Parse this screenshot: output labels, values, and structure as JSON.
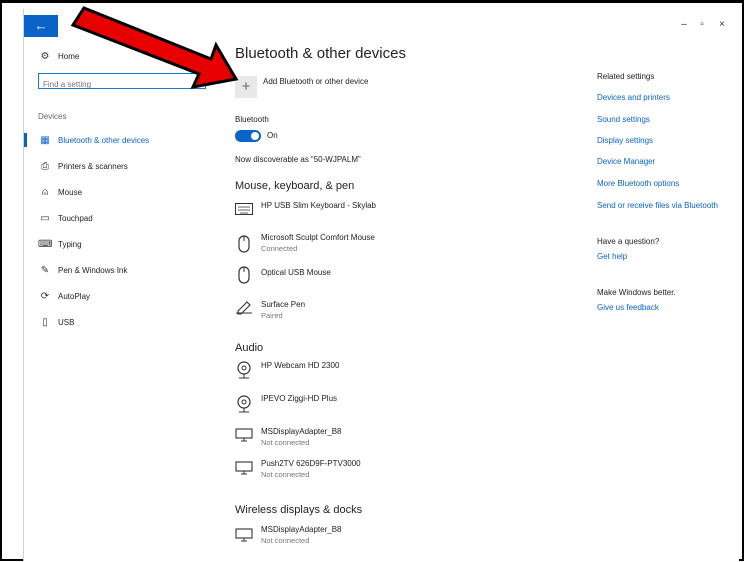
{
  "window": {
    "back_icon": "←",
    "minimize_icon": "–",
    "restore_icon": "▫",
    "close_icon": "×"
  },
  "nav": {
    "home_label": "Home",
    "search_placeholder": "Find a setting",
    "section_label": "Devices",
    "items": [
      {
        "label": "Bluetooth & other devices",
        "icon": "bluetooth-devices-icon",
        "active": true
      },
      {
        "label": "Printers & scanners",
        "icon": "printer-icon"
      },
      {
        "label": "Mouse",
        "icon": "mouse-icon"
      },
      {
        "label": "Touchpad",
        "icon": "touchpad-icon"
      },
      {
        "label": "Typing",
        "icon": "keyboard-icon"
      },
      {
        "label": "Pen & Windows Ink",
        "icon": "pen-icon"
      },
      {
        "label": "AutoPlay",
        "icon": "autoplay-icon"
      },
      {
        "label": "USB",
        "icon": "usb-icon"
      }
    ]
  },
  "main": {
    "title": "Bluetooth & other devices",
    "add_label": "Add Bluetooth or other device",
    "bluetooth_label": "Bluetooth",
    "bluetooth_state": "On",
    "discoverable": "Now discoverable as “50-WJPALM”",
    "sections": {
      "mouse": {
        "title": "Mouse, keyboard, & pen",
        "devices": [
          {
            "name": "HP USB Slim Keyboard - Skylab",
            "status": "",
            "icon": "keyboard-icon"
          },
          {
            "name": "Microsoft Sculpt Comfort Mouse",
            "status": "Connected",
            "icon": "mouse-icon"
          },
          {
            "name": "Optical USB Mouse",
            "status": "",
            "icon": "mouse-icon"
          },
          {
            "name": "Surface Pen",
            "status": "Paired",
            "icon": "pen-icon"
          }
        ]
      },
      "audio": {
        "title": "Audio",
        "devices": [
          {
            "name": "HP Webcam HD 2300",
            "status": "",
            "icon": "webcam-icon"
          },
          {
            "name": "IPEVO Ziggi-HD Plus",
            "status": "",
            "icon": "webcam-icon"
          },
          {
            "name": "MSDisplayAdapter_B8",
            "status": "Not connected",
            "icon": "monitor-icon"
          },
          {
            "name": "Push2TV 626D9F-PTV3000",
            "status": "Not connected",
            "icon": "monitor-icon"
          }
        ]
      },
      "wireless": {
        "title": "Wireless displays & docks",
        "devices": [
          {
            "name": "MSDisplayAdapter_B8",
            "status": "Not connected",
            "icon": "monitor-icon"
          }
        ]
      }
    }
  },
  "related": {
    "heading": "Related settings",
    "links": [
      "Devices and printers",
      "Sound settings",
      "Display settings",
      "Device Manager",
      "More Bluetooth options",
      "Send or receive files via Bluetooth"
    ],
    "question_heading": "Have a question?",
    "get_help": "Get help",
    "better_heading": "Make Windows better.",
    "feedback": "Give us feedback"
  },
  "colors": {
    "accent": "#0a63c9",
    "annotation_arrow": "#e60000"
  }
}
